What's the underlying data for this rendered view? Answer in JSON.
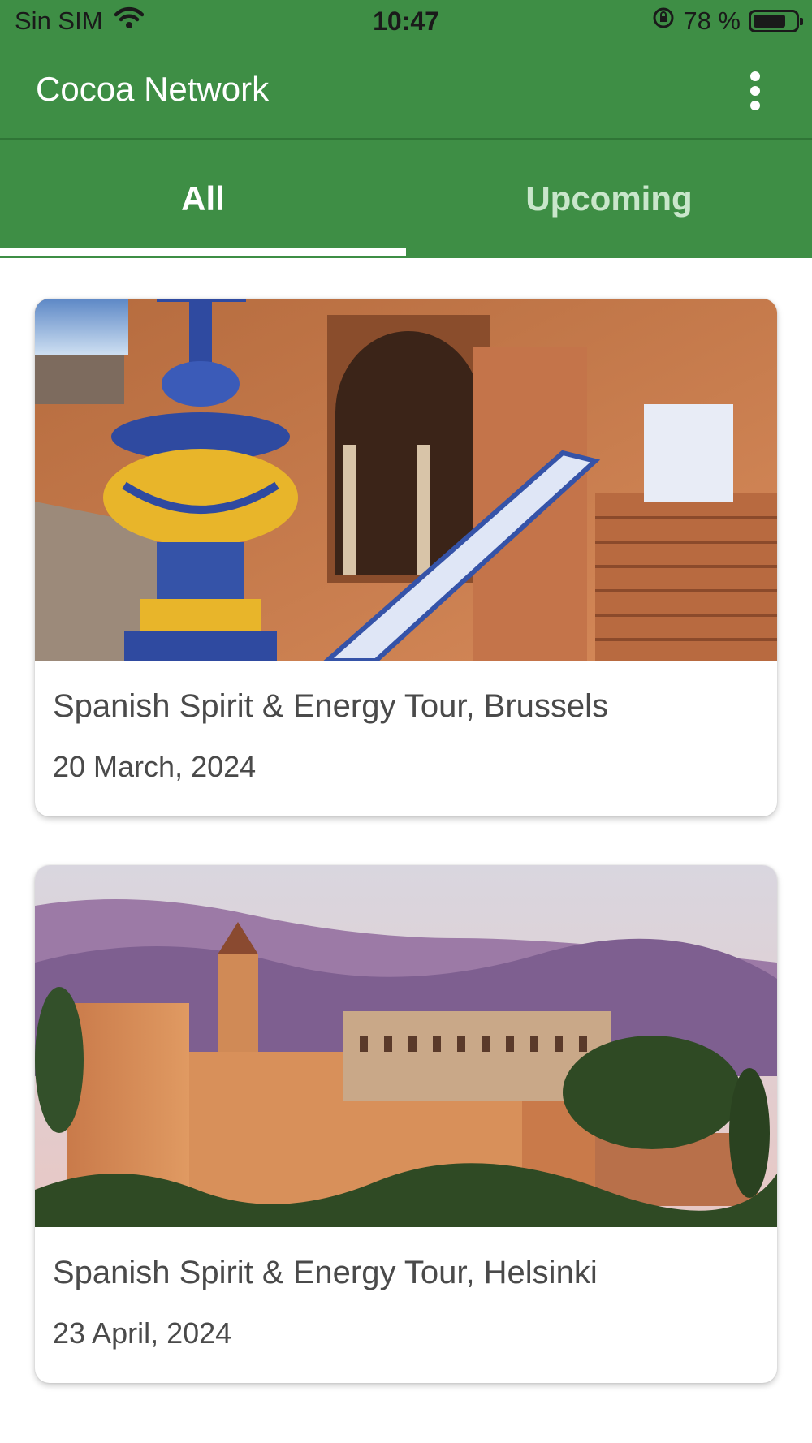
{
  "status_bar": {
    "carrier": "Sin SIM",
    "time": "10:47",
    "battery_text": "78 %",
    "battery_level": 0.78
  },
  "app_bar": {
    "title": "Cocoa Network",
    "menu_icon": "more-vert-icon"
  },
  "tabs": [
    {
      "label": "All",
      "active": true
    },
    {
      "label": "Upcoming",
      "active": false
    }
  ],
  "events": [
    {
      "title": "Spanish Spirit & Energy Tour, Brussels",
      "date": "20 March, 2024"
    },
    {
      "title": "Spanish Spirit & Energy Tour, Helsinki",
      "date": "23 April, 2024"
    }
  ],
  "colors": {
    "primary": "#3e8e45",
    "tab_inactive": "#c9e6cb",
    "text": "#4a4a4a"
  }
}
